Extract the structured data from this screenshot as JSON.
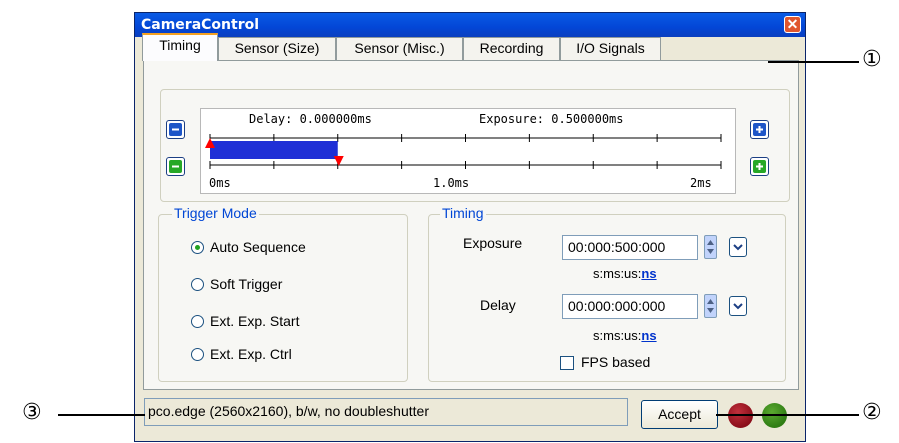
{
  "window": {
    "title": "CameraControl",
    "close_glyph": "✕"
  },
  "tabs": [
    {
      "label": "Timing",
      "active": true
    },
    {
      "label": "Sensor (Size)"
    },
    {
      "label": "Sensor (Misc.)"
    },
    {
      "label": "Recording"
    },
    {
      "label": "I/O Signals"
    }
  ],
  "timeline": {
    "delay_label": "Delay: 0.000000ms",
    "exposure_label": "Exposure: 0.500000ms",
    "ticks": [
      "0ms",
      "1.0ms",
      "2ms"
    ],
    "delay_ms": 0,
    "exposure_ms": 0.5,
    "range_ms": [
      0,
      2
    ],
    "bar_color": "#1f2fd6",
    "marker_color": "#ff0000",
    "zoom_out_icon": "minus-icon",
    "zoom_in_icon": "plus-icon",
    "shrink_icon": "green-minus-icon",
    "grow_icon": "green-plus-icon"
  },
  "trigger_mode": {
    "title": "Trigger Mode",
    "options": [
      {
        "label": "Auto Sequence",
        "selected": true
      },
      {
        "label": "Soft Trigger",
        "selected": false
      },
      {
        "label": "Ext. Exp. Start",
        "selected": false
      },
      {
        "label": "Ext. Exp. Ctrl",
        "selected": false
      }
    ]
  },
  "timing": {
    "title": "Timing",
    "exposure_label": "Exposure",
    "exposure_value": "00:000:500:000",
    "exposure_units_prefix": "s:ms:us:",
    "exposure_units_active": "ns",
    "delay_label": "Delay",
    "delay_value": "00:000:000:000",
    "delay_units_prefix": "s:ms:us:",
    "delay_units_active": "ns",
    "fps_label": "FPS based",
    "fps_checked": false
  },
  "status": {
    "text": "pco.edge (2560x2160), b/w, no doubleshutter",
    "accept_label": "Accept",
    "led_colors": [
      "#8b0e1a",
      "#2f7d14"
    ]
  },
  "callouts": [
    "①",
    "②",
    "③"
  ]
}
